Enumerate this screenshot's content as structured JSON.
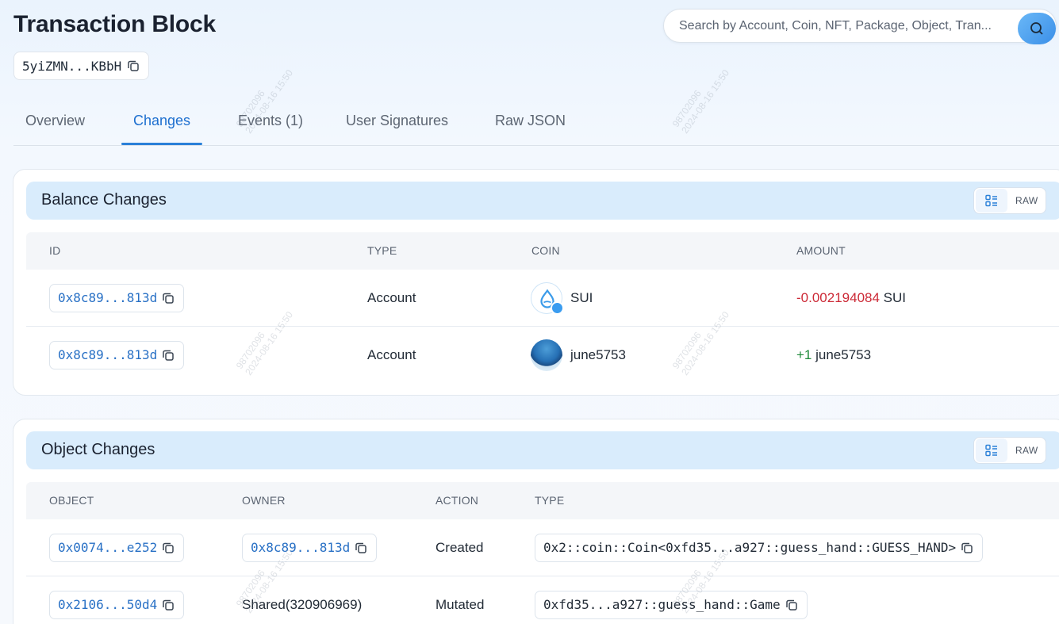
{
  "header": {
    "title": "Transaction Block",
    "digest": "5yiZMN...KBbH"
  },
  "search": {
    "placeholder": "Search by Account, Coin, NFT, Package, Object, Tran..."
  },
  "tabs": [
    {
      "label": "Overview",
      "active": false
    },
    {
      "label": "Changes",
      "active": true
    },
    {
      "label": "Events (1)",
      "active": false
    },
    {
      "label": "User Signatures",
      "active": false
    },
    {
      "label": "Raw JSON",
      "active": false
    }
  ],
  "balance_changes": {
    "title": "Balance Changes",
    "raw_label": "RAW",
    "columns": [
      "ID",
      "TYPE",
      "COIN",
      "AMOUNT"
    ],
    "rows": [
      {
        "id": "0x8c89...813d",
        "type": "Account",
        "coin": "SUI",
        "amount_value": "-0.002194084",
        "amount_unit": "SUI",
        "sign": "negative"
      },
      {
        "id": "0x8c89...813d",
        "type": "Account",
        "coin": "june5753",
        "amount_value": "+1",
        "amount_unit": "june5753",
        "sign": "positive"
      }
    ]
  },
  "object_changes": {
    "title": "Object Changes",
    "raw_label": "RAW",
    "columns": [
      "OBJECT",
      "OWNER",
      "ACTION",
      "TYPE"
    ],
    "rows": [
      {
        "object": "0x0074...e252",
        "owner": "0x8c89...813d",
        "action": "Created",
        "type": "0x2::coin::Coin<0xfd35...a927::guess_hand::GUESS_HAND>"
      },
      {
        "object": "0x2106...50d4",
        "owner": "Shared(320906969)",
        "action": "Mutated",
        "type": "0xfd35...a927::guess_hand::Game"
      }
    ]
  },
  "watermark": {
    "line1": "98702096",
    "line2": "2024-08-16 15:50"
  },
  "colors": {
    "accent": "#2a80d8",
    "negative": "#cc2936",
    "positive": "#1f8a3a",
    "header_bg": "#d9ecfc"
  }
}
